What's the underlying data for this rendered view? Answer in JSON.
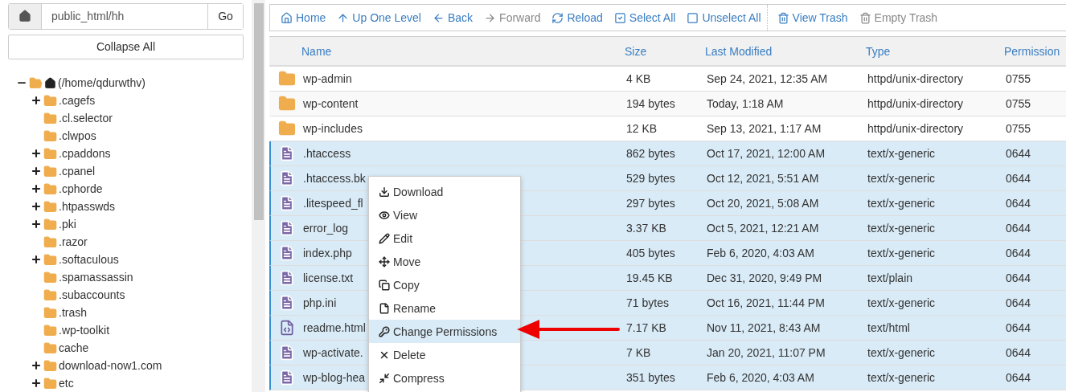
{
  "path_bar": {
    "value": "public_html/hh",
    "go_label": "Go"
  },
  "collapse_label": "Collapse All",
  "tree": {
    "label": "(/home/qdurwthv)",
    "expanded": true,
    "children": [
      {
        "label": ".cagefs",
        "has_children": true
      },
      {
        "label": ".cl.selector",
        "has_children": false
      },
      {
        "label": ".clwpos",
        "has_children": false
      },
      {
        "label": ".cpaddons",
        "has_children": true
      },
      {
        "label": ".cpanel",
        "has_children": true
      },
      {
        "label": ".cphorde",
        "has_children": true
      },
      {
        "label": ".htpasswds",
        "has_children": true
      },
      {
        "label": ".pki",
        "has_children": true
      },
      {
        "label": ".razor",
        "has_children": false
      },
      {
        "label": ".softaculous",
        "has_children": true
      },
      {
        "label": ".spamassassin",
        "has_children": false
      },
      {
        "label": ".subaccounts",
        "has_children": false
      },
      {
        "label": ".trash",
        "has_children": false
      },
      {
        "label": ".wp-toolkit",
        "has_children": false
      },
      {
        "label": "cache",
        "has_children": false
      },
      {
        "label": "download-now1.com",
        "has_children": true
      },
      {
        "label": "etc",
        "has_children": true
      }
    ]
  },
  "toolbar": [
    {
      "label": "Home",
      "kind": "home",
      "disabled": false
    },
    {
      "label": "Up One Level",
      "kind": "up",
      "disabled": false
    },
    {
      "label": "Back",
      "kind": "back",
      "disabled": false
    },
    {
      "label": "Forward",
      "kind": "forward",
      "disabled": true
    },
    {
      "label": "Reload",
      "kind": "reload",
      "disabled": false
    },
    {
      "label": "Select All",
      "kind": "select",
      "disabled": false
    },
    {
      "label": "Unselect All",
      "kind": "unselect",
      "disabled": false
    },
    {
      "label": "View Trash",
      "kind": "trash",
      "disabled": false,
      "separator_before": true
    },
    {
      "label": "Empty Trash",
      "kind": "trash",
      "disabled": true
    }
  ],
  "table": {
    "columns": [
      "Name",
      "Size",
      "Last Modified",
      "Type",
      "Permission"
    ],
    "rows": [
      {
        "kind": "folder",
        "selected": false,
        "cells": [
          "wp-admin",
          "4 KB",
          "Sep 24, 2021, 12:35 AM",
          "httpd/unix-directory",
          "0755"
        ]
      },
      {
        "kind": "folder",
        "selected": false,
        "cells": [
          "wp-content",
          "194 bytes",
          "Today, 1:18 AM",
          "httpd/unix-directory",
          "0755"
        ]
      },
      {
        "kind": "folder",
        "selected": false,
        "cells": [
          "wp-includes",
          "12 KB",
          "Sep 13, 2021, 1:17 AM",
          "httpd/unix-directory",
          "0755"
        ]
      },
      {
        "kind": "text",
        "selected": true,
        "cells": [
          ".htaccess",
          "862 bytes",
          "Oct 17, 2021, 12:00 AM",
          "text/x-generic",
          "0644"
        ]
      },
      {
        "kind": "text",
        "selected": true,
        "cells": [
          ".htaccess.bk",
          "529 bytes",
          "Oct 12, 2021, 5:51 AM",
          "text/x-generic",
          "0644"
        ]
      },
      {
        "kind": "text",
        "selected": true,
        "cells": [
          ".litespeed_fl",
          "297 bytes",
          "Oct 20, 2021, 5:08 AM",
          "text/x-generic",
          "0644"
        ]
      },
      {
        "kind": "text",
        "selected": true,
        "cells": [
          "error_log",
          "3.37 KB",
          "Oct 5, 2021, 12:21 AM",
          "text/x-generic",
          "0644"
        ]
      },
      {
        "kind": "text",
        "selected": true,
        "cells": [
          "index.php",
          "405 bytes",
          "Feb 6, 2020, 4:03 AM",
          "text/x-generic",
          "0644"
        ]
      },
      {
        "kind": "text",
        "selected": true,
        "cells": [
          "license.txt",
          "19.45 KB",
          "Dec 31, 2020, 9:49 PM",
          "text/plain",
          "0644"
        ]
      },
      {
        "kind": "text",
        "selected": true,
        "cells": [
          "php.ini",
          "71 bytes",
          "Oct 16, 2021, 11:44 PM",
          "text/x-generic",
          "0644"
        ]
      },
      {
        "kind": "html",
        "selected": true,
        "cells": [
          "readme.html",
          "7.17 KB",
          "Nov 11, 2021, 8:43 AM",
          "text/html",
          "0644"
        ]
      },
      {
        "kind": "text",
        "selected": true,
        "cells": [
          "wp-activate.",
          "7 KB",
          "Jan 20, 2021, 11:07 PM",
          "text/x-generic",
          "0644"
        ]
      },
      {
        "kind": "text",
        "selected": true,
        "cells": [
          "wp-blog-hea",
          "351 bytes",
          "Feb 6, 2020, 4:03 AM",
          "text/x-generic",
          "0644"
        ]
      }
    ]
  },
  "context_menu": [
    {
      "label": "Download",
      "kind": "download",
      "selected": false
    },
    {
      "label": "View",
      "kind": "view",
      "selected": false
    },
    {
      "label": "Edit",
      "kind": "edit",
      "selected": false
    },
    {
      "label": "Move",
      "kind": "move",
      "selected": false
    },
    {
      "label": "Copy",
      "kind": "copy",
      "selected": false
    },
    {
      "label": "Rename",
      "kind": "rename",
      "selected": false
    },
    {
      "label": "Change Permissions",
      "kind": "permissions",
      "selected": true
    },
    {
      "label": "Delete",
      "kind": "delete",
      "selected": false
    },
    {
      "label": "Compress",
      "kind": "compress",
      "selected": false
    }
  ]
}
